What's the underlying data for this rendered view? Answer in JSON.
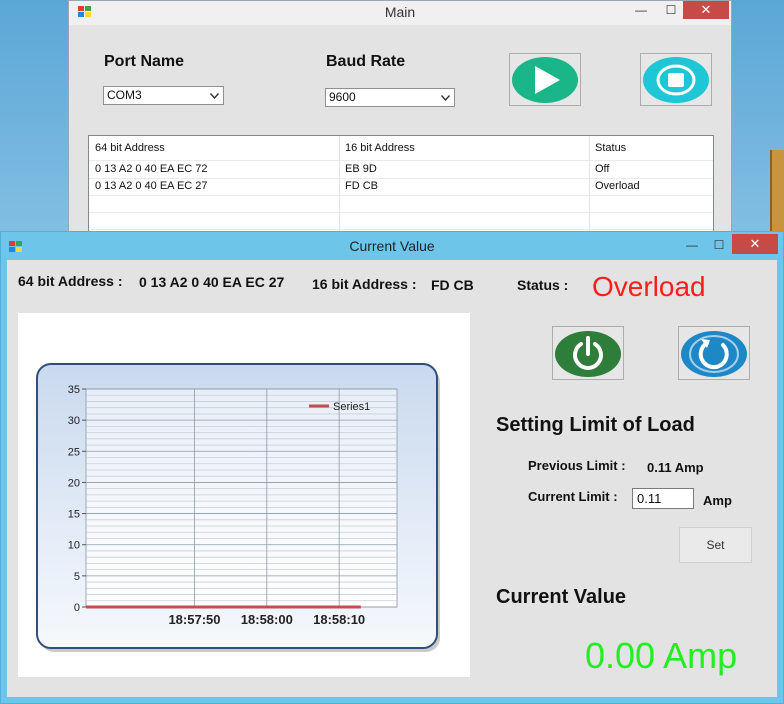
{
  "main_window": {
    "title": "Main",
    "minimize_glyph": "—",
    "maximize_glyph": "☐",
    "close_glyph": "✕",
    "port_label": "Port Name",
    "port_value": "COM3",
    "baud_label": "Baud Rate",
    "baud_value": "9600",
    "start_icon": "play-icon",
    "stop_icon": "stop-icon",
    "list": {
      "columns": [
        "64 bit Address",
        "16 bit Address",
        "Status"
      ],
      "rows": [
        {
          "addr64": "0 13 A2 0 40 EA EC 72",
          "addr16": "EB 9D",
          "status": "Off"
        },
        {
          "addr64": "0 13 A2 0 40 EA EC 27",
          "addr16": "FD CB",
          "status": "Overload"
        }
      ]
    }
  },
  "current_window": {
    "title": "Current Value",
    "minimize_glyph": "—",
    "maximize_glyph": "☐",
    "close_glyph": "✕",
    "addr64_label": "64 bit Address :",
    "addr64_value": "0 13 A2 0 40 EA EC 27",
    "addr16_label": "16 bit Address :",
    "addr16_value": "FD CB",
    "status_label": "Status :",
    "status_value": "Overload",
    "power_icon": "power-icon",
    "reset_icon": "refresh-icon",
    "limit_heading": "Setting Limit of Load",
    "previous_limit_label": "Previous Limit :",
    "previous_limit_value": "0.11 Amp",
    "current_limit_label": "Current Limit :",
    "current_limit_value": "0.11",
    "current_limit_unit": "Amp",
    "set_label": "Set",
    "current_value_heading": "Current Value",
    "current_value": "0.00 Amp"
  },
  "colors": {
    "status_overload": "#ff1c1c",
    "current_value_green": "#22ee22",
    "play_green": "#1bb58a",
    "stop_teal": "#1ec6d6",
    "power_green": "#2e7d3a",
    "reset_blue": "#1e88c7",
    "series_line": "#c0504d"
  },
  "chart_data": {
    "type": "line",
    "legend_position": "top-right",
    "grid": true,
    "ylim": [
      0,
      35
    ],
    "y_ticks": [
      "0",
      "5",
      "10",
      "15",
      "20",
      "25",
      "30",
      "35"
    ],
    "x_ticks": [
      "18:57:50",
      "18:58:00",
      "18:58:10"
    ],
    "x_range_seconds": [
      -25,
      18
    ],
    "series": [
      {
        "name": "Series1",
        "x_seconds": [
          -25,
          -22,
          -18,
          -14,
          -10,
          -6,
          -2,
          0,
          3,
          6,
          9,
          11,
          13
        ],
        "values": [
          0,
          0,
          0,
          0,
          0,
          0,
          0,
          0,
          0,
          0,
          0,
          0,
          0
        ]
      }
    ]
  }
}
